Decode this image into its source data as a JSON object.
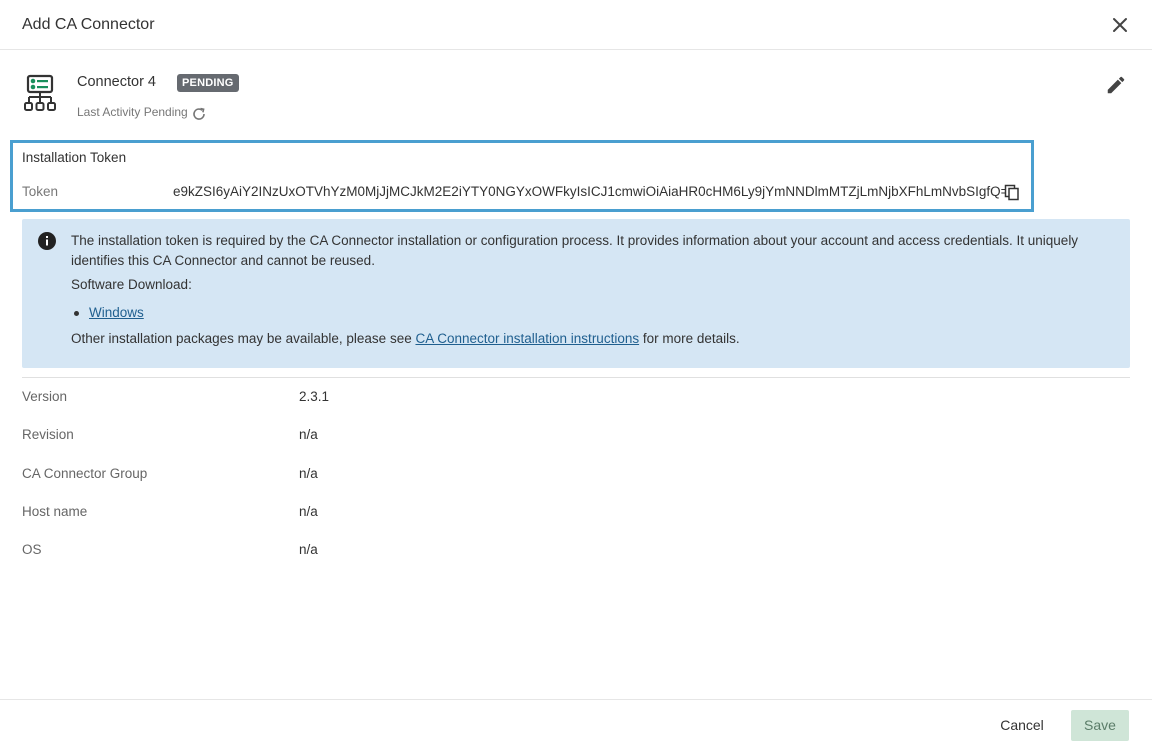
{
  "dialog": {
    "title": "Add CA Connector"
  },
  "connector": {
    "name": "Connector 4",
    "status_badge": "PENDING",
    "last_activity": "Last Activity Pending"
  },
  "token_section": {
    "title": "Installation Token",
    "label": "Token",
    "value": "e9kZSI6yAiY2INzUxOTVhYzM0MjJjMCJkM2E2iYTY0NGYxOWFkyIsICJ1cmwiOiAiaHR0cHM6Ly9jYmNNDlmMTZjLmNjbXFhLmNvbSIgfQ=="
  },
  "info": {
    "description": "The installation token is required by the CA Connector installation or configuration process. It provides information about your account and access credentials. It uniquely identifies this CA Connector and cannot be reused.",
    "software_download_label": "Software Download:",
    "download_links": [
      "Windows"
    ],
    "other_prefix": "Other installation packages may be available, please see ",
    "instructions_link": "CA Connector installation instructions",
    "other_suffix": " for more details."
  },
  "details": [
    {
      "label": "Version",
      "value": "2.3.1"
    },
    {
      "label": "Revision",
      "value": "n/a"
    },
    {
      "label": "CA Connector Group",
      "value": "n/a"
    },
    {
      "label": "Host name",
      "value": "n/a"
    },
    {
      "label": "OS",
      "value": "n/a"
    }
  ],
  "footer": {
    "cancel_label": "Cancel",
    "save_label": "Save"
  },
  "colors": {
    "accent_border": "#4a9fd0",
    "info_background": "#d5e6f4",
    "link": "#1f5f8f",
    "badge_background": "#666a70",
    "save_disabled_bg": "#cfe5d7",
    "connector_icon": "#1a8f5c"
  },
  "icons": {
    "close": "close-icon",
    "connector": "connector-icon",
    "refresh": "refresh-icon",
    "edit": "pencil-icon",
    "copy": "copy-icon",
    "info": "info-icon"
  }
}
